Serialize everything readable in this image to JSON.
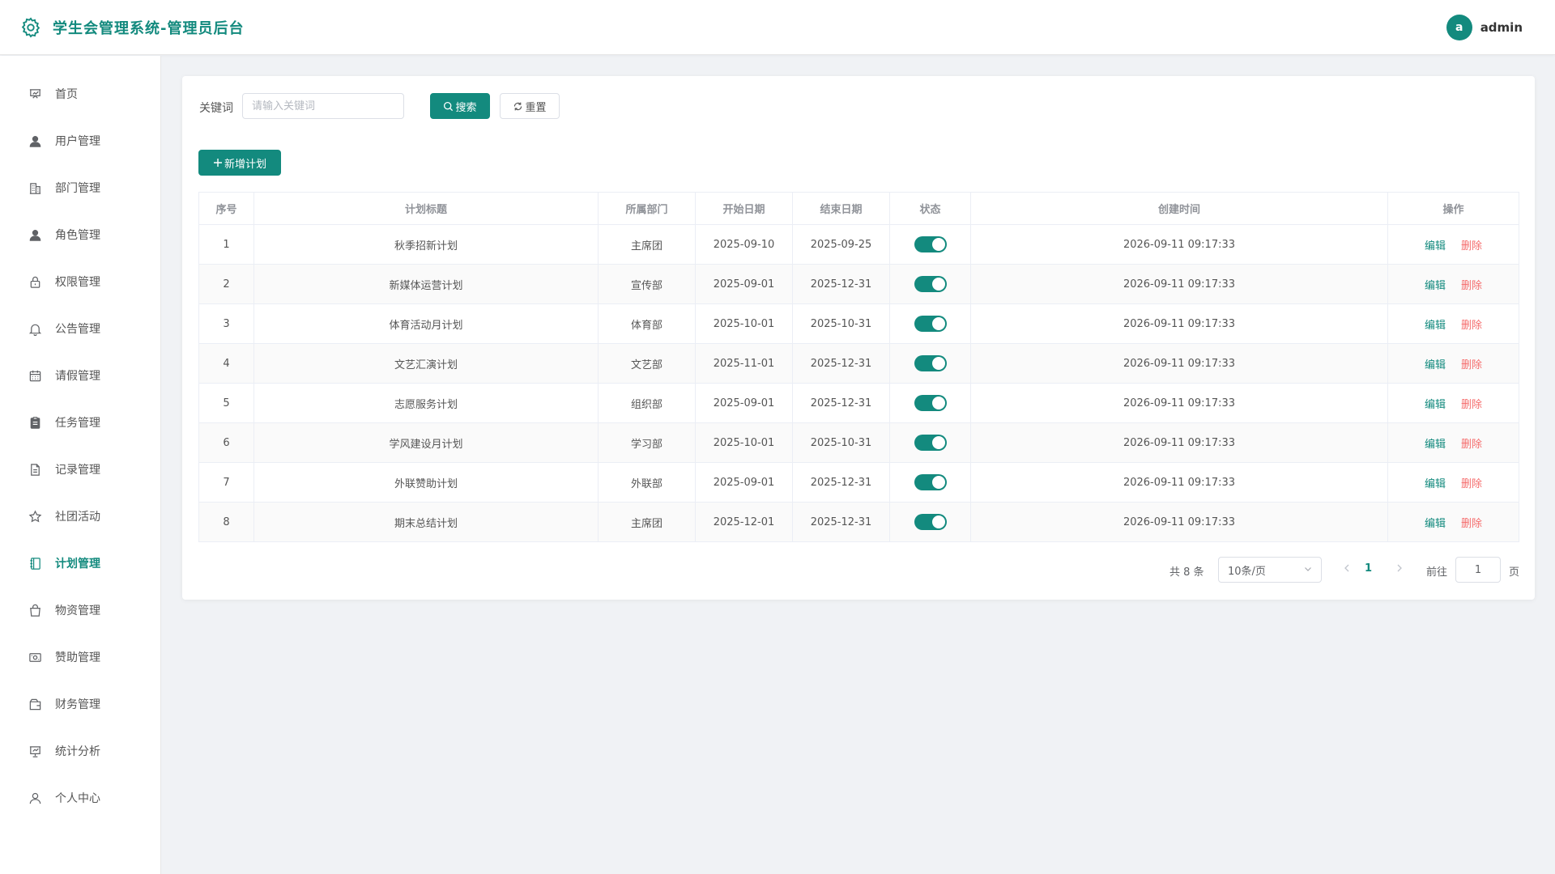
{
  "app": {
    "title": "学生会管理系统-管理员后台",
    "brand_color": "#138a7e",
    "user": {
      "avatar_letter": "a",
      "name": "admin"
    }
  },
  "sidebar": {
    "items": [
      {
        "label": "首页",
        "icon": "dashboard-icon",
        "active": false
      },
      {
        "label": "用户管理",
        "icon": "user-icon",
        "active": false
      },
      {
        "label": "部门管理",
        "icon": "office-building-icon",
        "active": false
      },
      {
        "label": "角色管理",
        "icon": "avatar-icon",
        "active": false
      },
      {
        "label": "权限管理",
        "icon": "lock-icon",
        "active": false
      },
      {
        "label": "公告管理",
        "icon": "bell-icon",
        "active": false
      },
      {
        "label": "请假管理",
        "icon": "calendar-icon",
        "active": false
      },
      {
        "label": "任务管理",
        "icon": "clipboard-icon",
        "active": false
      },
      {
        "label": "记录管理",
        "icon": "document-icon",
        "active": false
      },
      {
        "label": "社团活动",
        "icon": "star-icon",
        "active": false
      },
      {
        "label": "计划管理",
        "icon": "notebook-icon",
        "active": true
      },
      {
        "label": "物资管理",
        "icon": "shopping-bag-icon",
        "active": false
      },
      {
        "label": "赞助管理",
        "icon": "money-icon",
        "active": false
      },
      {
        "label": "财务管理",
        "icon": "wallet-icon",
        "active": false
      },
      {
        "label": "统计分析",
        "icon": "data-board-icon",
        "active": false
      },
      {
        "label": "个人中心",
        "icon": "person-icon",
        "active": false
      }
    ]
  },
  "search": {
    "label": "关键词",
    "placeholder": "请输入关键词",
    "value": "",
    "search_button": "搜索",
    "reset_button": "重置"
  },
  "toolbar": {
    "add_button": "新增计划"
  },
  "table": {
    "columns": [
      "序号",
      "计划标题",
      "所属部门",
      "开始日期",
      "结束日期",
      "状态",
      "创建时间",
      "操作"
    ],
    "edit_label": "编辑",
    "delete_label": "删除",
    "rows": [
      {
        "index": "1",
        "title": "秋季招新计划",
        "dept": "主席团",
        "start": "2025-09-10",
        "end": "2025-09-25",
        "enabled": true,
        "created": "2026-09-11 09:17:33"
      },
      {
        "index": "2",
        "title": "新媒体运营计划",
        "dept": "宣传部",
        "start": "2025-09-01",
        "end": "2025-12-31",
        "enabled": true,
        "created": "2026-09-11 09:17:33"
      },
      {
        "index": "3",
        "title": "体育活动月计划",
        "dept": "体育部",
        "start": "2025-10-01",
        "end": "2025-10-31",
        "enabled": true,
        "created": "2026-09-11 09:17:33"
      },
      {
        "index": "4",
        "title": "文艺汇演计划",
        "dept": "文艺部",
        "start": "2025-11-01",
        "end": "2025-12-31",
        "enabled": true,
        "created": "2026-09-11 09:17:33"
      },
      {
        "index": "5",
        "title": "志愿服务计划",
        "dept": "组织部",
        "start": "2025-09-01",
        "end": "2025-12-31",
        "enabled": true,
        "created": "2026-09-11 09:17:33"
      },
      {
        "index": "6",
        "title": "学风建设月计划",
        "dept": "学习部",
        "start": "2025-10-01",
        "end": "2025-10-31",
        "enabled": true,
        "created": "2026-09-11 09:17:33"
      },
      {
        "index": "7",
        "title": "外联赞助计划",
        "dept": "外联部",
        "start": "2025-09-01",
        "end": "2025-12-31",
        "enabled": true,
        "created": "2026-09-11 09:17:33"
      },
      {
        "index": "8",
        "title": "期末总结计划",
        "dept": "主席团",
        "start": "2025-12-01",
        "end": "2025-12-31",
        "enabled": true,
        "created": "2026-09-11 09:17:33"
      }
    ]
  },
  "pagination": {
    "total_text": "共 8 条",
    "page_size": "10条/页",
    "current_page": "1",
    "goto_label": "前往",
    "goto_value": "1",
    "page_unit": "页"
  }
}
